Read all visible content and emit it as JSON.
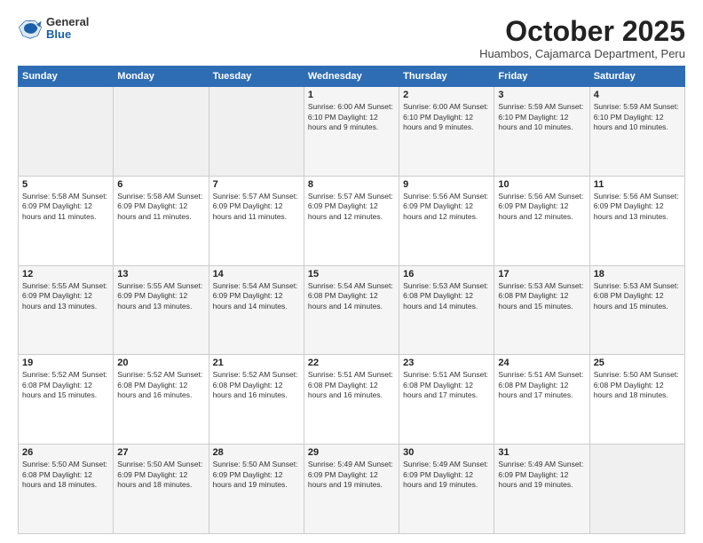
{
  "header": {
    "logo": {
      "general": "General",
      "blue": "Blue"
    },
    "title": "October 2025",
    "subtitle": "Huambos, Cajamarca Department, Peru"
  },
  "calendar": {
    "days_of_week": [
      "Sunday",
      "Monday",
      "Tuesday",
      "Wednesday",
      "Thursday",
      "Friday",
      "Saturday"
    ],
    "weeks": [
      [
        {
          "day": "",
          "info": ""
        },
        {
          "day": "",
          "info": ""
        },
        {
          "day": "",
          "info": ""
        },
        {
          "day": "1",
          "info": "Sunrise: 6:00 AM\nSunset: 6:10 PM\nDaylight: 12 hours and 9 minutes."
        },
        {
          "day": "2",
          "info": "Sunrise: 6:00 AM\nSunset: 6:10 PM\nDaylight: 12 hours and 9 minutes."
        },
        {
          "day": "3",
          "info": "Sunrise: 5:59 AM\nSunset: 6:10 PM\nDaylight: 12 hours and 10 minutes."
        },
        {
          "day": "4",
          "info": "Sunrise: 5:59 AM\nSunset: 6:10 PM\nDaylight: 12 hours and 10 minutes."
        }
      ],
      [
        {
          "day": "5",
          "info": "Sunrise: 5:58 AM\nSunset: 6:09 PM\nDaylight: 12 hours and 11 minutes."
        },
        {
          "day": "6",
          "info": "Sunrise: 5:58 AM\nSunset: 6:09 PM\nDaylight: 12 hours and 11 minutes."
        },
        {
          "day": "7",
          "info": "Sunrise: 5:57 AM\nSunset: 6:09 PM\nDaylight: 12 hours and 11 minutes."
        },
        {
          "day": "8",
          "info": "Sunrise: 5:57 AM\nSunset: 6:09 PM\nDaylight: 12 hours and 12 minutes."
        },
        {
          "day": "9",
          "info": "Sunrise: 5:56 AM\nSunset: 6:09 PM\nDaylight: 12 hours and 12 minutes."
        },
        {
          "day": "10",
          "info": "Sunrise: 5:56 AM\nSunset: 6:09 PM\nDaylight: 12 hours and 12 minutes."
        },
        {
          "day": "11",
          "info": "Sunrise: 5:56 AM\nSunset: 6:09 PM\nDaylight: 12 hours and 13 minutes."
        }
      ],
      [
        {
          "day": "12",
          "info": "Sunrise: 5:55 AM\nSunset: 6:09 PM\nDaylight: 12 hours and 13 minutes."
        },
        {
          "day": "13",
          "info": "Sunrise: 5:55 AM\nSunset: 6:09 PM\nDaylight: 12 hours and 13 minutes."
        },
        {
          "day": "14",
          "info": "Sunrise: 5:54 AM\nSunset: 6:09 PM\nDaylight: 12 hours and 14 minutes."
        },
        {
          "day": "15",
          "info": "Sunrise: 5:54 AM\nSunset: 6:08 PM\nDaylight: 12 hours and 14 minutes."
        },
        {
          "day": "16",
          "info": "Sunrise: 5:53 AM\nSunset: 6:08 PM\nDaylight: 12 hours and 14 minutes."
        },
        {
          "day": "17",
          "info": "Sunrise: 5:53 AM\nSunset: 6:08 PM\nDaylight: 12 hours and 15 minutes."
        },
        {
          "day": "18",
          "info": "Sunrise: 5:53 AM\nSunset: 6:08 PM\nDaylight: 12 hours and 15 minutes."
        }
      ],
      [
        {
          "day": "19",
          "info": "Sunrise: 5:52 AM\nSunset: 6:08 PM\nDaylight: 12 hours and 15 minutes."
        },
        {
          "day": "20",
          "info": "Sunrise: 5:52 AM\nSunset: 6:08 PM\nDaylight: 12 hours and 16 minutes."
        },
        {
          "day": "21",
          "info": "Sunrise: 5:52 AM\nSunset: 6:08 PM\nDaylight: 12 hours and 16 minutes."
        },
        {
          "day": "22",
          "info": "Sunrise: 5:51 AM\nSunset: 6:08 PM\nDaylight: 12 hours and 16 minutes."
        },
        {
          "day": "23",
          "info": "Sunrise: 5:51 AM\nSunset: 6:08 PM\nDaylight: 12 hours and 17 minutes."
        },
        {
          "day": "24",
          "info": "Sunrise: 5:51 AM\nSunset: 6:08 PM\nDaylight: 12 hours and 17 minutes."
        },
        {
          "day": "25",
          "info": "Sunrise: 5:50 AM\nSunset: 6:08 PM\nDaylight: 12 hours and 18 minutes."
        }
      ],
      [
        {
          "day": "26",
          "info": "Sunrise: 5:50 AM\nSunset: 6:08 PM\nDaylight: 12 hours and 18 minutes."
        },
        {
          "day": "27",
          "info": "Sunrise: 5:50 AM\nSunset: 6:09 PM\nDaylight: 12 hours and 18 minutes."
        },
        {
          "day": "28",
          "info": "Sunrise: 5:50 AM\nSunset: 6:09 PM\nDaylight: 12 hours and 19 minutes."
        },
        {
          "day": "29",
          "info": "Sunrise: 5:49 AM\nSunset: 6:09 PM\nDaylight: 12 hours and 19 minutes."
        },
        {
          "day": "30",
          "info": "Sunrise: 5:49 AM\nSunset: 6:09 PM\nDaylight: 12 hours and 19 minutes."
        },
        {
          "day": "31",
          "info": "Sunrise: 5:49 AM\nSunset: 6:09 PM\nDaylight: 12 hours and 19 minutes."
        },
        {
          "day": "",
          "info": ""
        }
      ]
    ]
  }
}
